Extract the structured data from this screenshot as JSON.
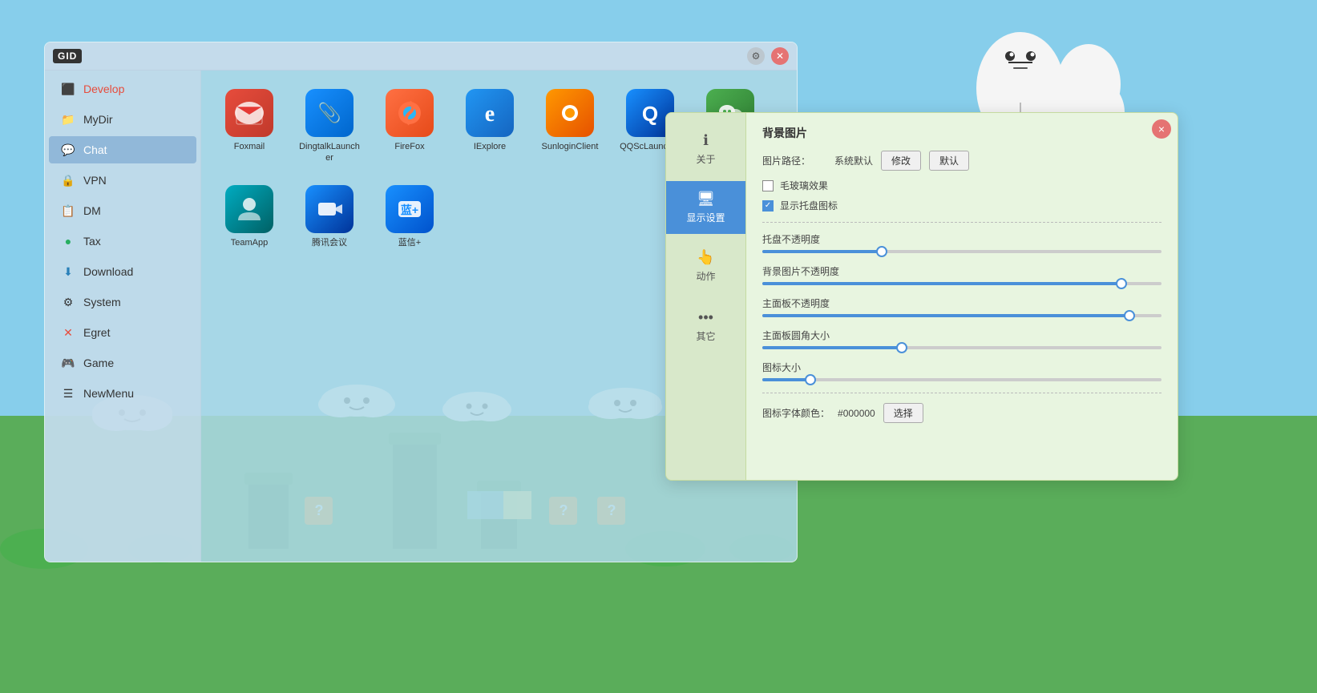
{
  "desktop": {
    "bg_color": "#87CEEB"
  },
  "launcher": {
    "logo": "GID",
    "titlebar_gear_title": "Settings",
    "titlebar_close_title": "Close"
  },
  "sidebar": {
    "items": [
      {
        "id": "develop",
        "label": "Develop",
        "icon": "⬛"
      },
      {
        "id": "mydir",
        "label": "MyDir",
        "icon": "📁"
      },
      {
        "id": "chat",
        "label": "Chat",
        "icon": "💬"
      },
      {
        "id": "vpn",
        "label": "VPN",
        "icon": "🔒"
      },
      {
        "id": "dm",
        "label": "DM",
        "icon": "📋"
      },
      {
        "id": "tax",
        "label": "Tax",
        "icon": "●"
      },
      {
        "id": "download",
        "label": "Download",
        "icon": "⬇"
      },
      {
        "id": "system",
        "label": "System",
        "icon": "⚙"
      },
      {
        "id": "egret",
        "label": "Egret",
        "icon": "✕"
      },
      {
        "id": "game",
        "label": "Game",
        "icon": "🎮"
      },
      {
        "id": "newmenu",
        "label": "NewMenu",
        "icon": "☰"
      }
    ]
  },
  "apps": [
    {
      "id": "foxmail",
      "label": "Foxmail",
      "icon": "🦊",
      "color_class": "foxmail-icon"
    },
    {
      "id": "dingtalk",
      "label": "DingtalkLauncher",
      "icon": "📎",
      "color_class": "dingtalk-icon"
    },
    {
      "id": "firefox",
      "label": "FireFox",
      "icon": "🔥",
      "color_class": "firefox-icon"
    },
    {
      "id": "ie",
      "label": "IExplore",
      "icon": "e",
      "color_class": "ie-icon"
    },
    {
      "id": "sunlogin",
      "label": "SunloginClient",
      "icon": "☀",
      "color_class": "sunlogin-icon"
    },
    {
      "id": "qqsc",
      "label": "QQScLauncher",
      "icon": "Q",
      "color_class": "qqsc-icon"
    },
    {
      "id": "wechat",
      "label": "WeChat",
      "icon": "💬",
      "color_class": "wechat-icon"
    },
    {
      "id": "teamapp",
      "label": "TeamApp",
      "icon": "T",
      "color_class": "teamapp-icon"
    },
    {
      "id": "tencent",
      "label": "腾讯会议",
      "icon": "📹",
      "color_class": "tencent-icon"
    },
    {
      "id": "lanxin",
      "label": "蓝信+",
      "icon": "✉",
      "color_class": "lanxin-icon"
    }
  ],
  "settings": {
    "title": "背景图片",
    "close_btn": "×",
    "nav_items": [
      {
        "id": "about",
        "label": "关于",
        "icon": "ℹ"
      },
      {
        "id": "display",
        "label": "显示设置",
        "icon": "🖥",
        "active": true
      },
      {
        "id": "motion",
        "label": "动作",
        "icon": "👆"
      },
      {
        "id": "other",
        "label": "其它",
        "icon": "•••"
      }
    ],
    "wallpaper": {
      "title": "背景图片",
      "path_label": "图片路径：",
      "path_value": "系统默认",
      "modify_btn": "修改",
      "default_btn": "默认",
      "frosted_glass_label": "毛玻璃效果",
      "frosted_glass_checked": false,
      "show_tray_label": "显示托盘图标",
      "show_tray_checked": true
    },
    "sliders": [
      {
        "id": "tray_opacity",
        "label": "托盘不透明度",
        "value": 30,
        "max": 100,
        "fill_color": "#4a90d9"
      },
      {
        "id": "bg_opacity",
        "label": "背景图片不透明度",
        "value": 90,
        "max": 100,
        "fill_color": "#4a90d9"
      },
      {
        "id": "panel_opacity",
        "label": "主面板不透明度",
        "value": 92,
        "max": 100,
        "fill_color": "#4a90d9"
      },
      {
        "id": "panel_radius",
        "label": "主面板圆角大小",
        "value": 35,
        "max": 100,
        "fill_color": "#4a90d9"
      },
      {
        "id": "icon_size",
        "label": "图标大小",
        "value": 12,
        "max": 100,
        "fill_color": "#4a90d9"
      }
    ],
    "icon_font_color_label": "图标字体颜色：",
    "icon_font_color_value": "#000000",
    "select_color_btn": "选择"
  }
}
